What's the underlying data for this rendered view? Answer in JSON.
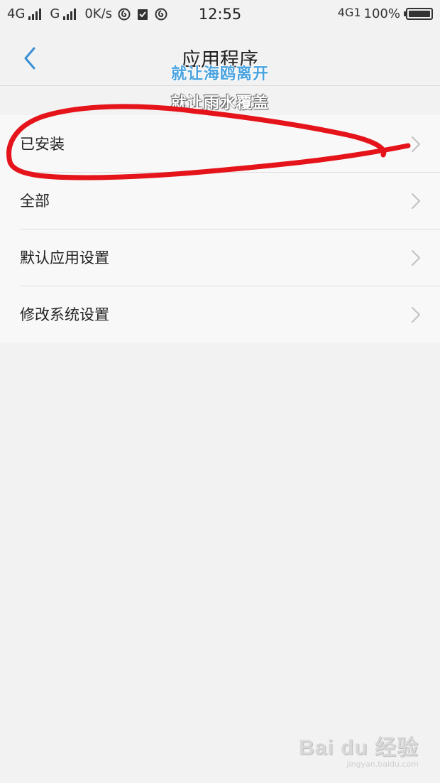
{
  "status_bar": {
    "net1": "4G",
    "net2": "G",
    "speed": "0K/s",
    "time": "12:55",
    "net_right": "4G1",
    "battery": "100%",
    "icons": [
      "signal-icon",
      "signal-icon",
      "netease-music-icon",
      "clipboard-check-icon",
      "netease-music-icon",
      "battery-icon"
    ]
  },
  "nav": {
    "title": "应用程序",
    "back_icon": "chevron-left-icon"
  },
  "watermark": {
    "line1": "就让海鸥离开",
    "line2": "就让雨水覆盖"
  },
  "menu": {
    "items": [
      {
        "label": "已安装"
      },
      {
        "label": "全部"
      },
      {
        "label": "默认应用设置"
      },
      {
        "label": "修改系统设置"
      }
    ],
    "item_icon": "chevron-right-icon"
  },
  "logo": {
    "main": "Bai du 经验",
    "sub": "jingyan.baidu.com"
  },
  "colors": {
    "accent": "#3a8fd6",
    "annotation": "#e5141b",
    "background": "#f2f2f2",
    "list_bg": "#f8f8f8"
  }
}
